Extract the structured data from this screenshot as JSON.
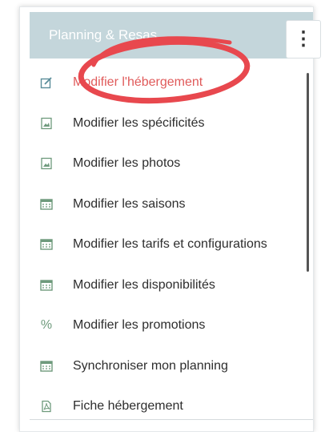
{
  "header": {
    "title": "Planning & Resas"
  },
  "menu": {
    "items": [
      {
        "label": "Modifier l'hébergement",
        "icon": "edit-icon",
        "active": true
      },
      {
        "label": "Modifier les spécificités",
        "icon": "image-icon"
      },
      {
        "label": "Modifier les photos",
        "icon": "image-icon"
      },
      {
        "label": "Modifier les saisons",
        "icon": "calendar-icon"
      },
      {
        "label": "Modifier les tarifs et configurations",
        "icon": "calendar-icon"
      },
      {
        "label": "Modifier les disponibilités",
        "icon": "calendar-icon"
      },
      {
        "label": "Modifier les promotions",
        "icon": "percent-icon"
      },
      {
        "label": "Synchroniser mon planning",
        "icon": "calendar-icon"
      },
      {
        "label": "Fiche hébergement",
        "icon": "pdf-icon"
      }
    ]
  },
  "colors": {
    "header_bg": "#c4d6db",
    "active_text": "#e05a5a",
    "highlight_circle": "#e8484e",
    "icon_green": "#6e9a7c"
  }
}
